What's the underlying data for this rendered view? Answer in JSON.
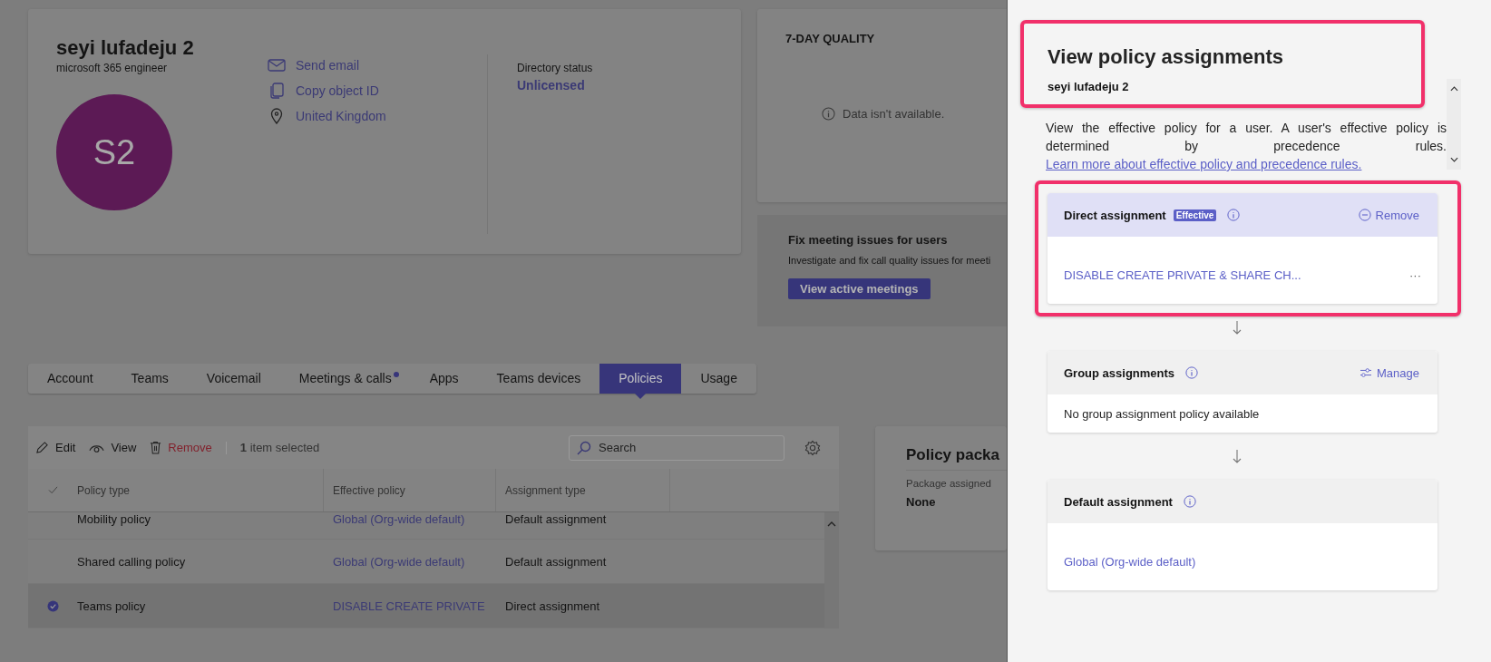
{
  "profile": {
    "name": "seyi lufadeju 2",
    "role": "microsoft 365 engineer",
    "initials": "S2",
    "actions": [
      {
        "kind": "email",
        "label": "Send email"
      },
      {
        "kind": "copy",
        "label": "Copy object ID"
      },
      {
        "kind": "location",
        "label": "United Kingdom"
      }
    ],
    "status_label": "Directory status",
    "status_value": "Unlicensed"
  },
  "quality": {
    "title": "7-DAY QUALITY",
    "message": "Data isn't available."
  },
  "fix_meetings": {
    "title": "Fix meeting issues for users",
    "description": "Investigate and fix call quality issues for meeti",
    "button": "View active meetings"
  },
  "tabs": [
    {
      "label": "Account",
      "selected": false,
      "dot": false
    },
    {
      "label": "Teams",
      "selected": false,
      "dot": false
    },
    {
      "label": "Voicemail",
      "selected": false,
      "dot": false
    },
    {
      "label": "Meetings & calls",
      "selected": false,
      "dot": true
    },
    {
      "label": "Apps",
      "selected": false,
      "dot": false
    },
    {
      "label": "Teams devices",
      "selected": false,
      "dot": false
    },
    {
      "label": "Policies",
      "selected": true,
      "dot": false
    },
    {
      "label": "Usage",
      "selected": false,
      "dot": false
    }
  ],
  "toolbar": {
    "actions": [
      {
        "kind": "edit",
        "label": "Edit"
      },
      {
        "kind": "view",
        "label": "View"
      },
      {
        "kind": "remove",
        "label": "Remove"
      }
    ],
    "selection_count": "1",
    "selection_text": "item selected",
    "search": {
      "placeholder": "Search"
    }
  },
  "table": {
    "columns": [
      "Policy type",
      "Effective policy",
      "Assignment type"
    ],
    "rows": [
      {
        "selected": false,
        "cells": [
          "Mobility policy",
          "Global (Org-wide default)",
          "Default assignment"
        ]
      },
      {
        "selected": false,
        "cells": [
          "Shared calling policy",
          "Global (Org-wide default)",
          "Default assignment"
        ]
      },
      {
        "selected": true,
        "cells": [
          "Teams policy",
          "DISABLE CREATE PRIVATE",
          "Direct assignment"
        ]
      }
    ]
  },
  "policy_package": {
    "title": "Policy packa",
    "label": "Package assigned",
    "value": "None"
  },
  "panel": {
    "title": "View policy assignments",
    "user": "seyi lufadeju 2",
    "highlighted": true,
    "description": "View the effective policy for a user. A user's effective policy is determined by precedence rules.",
    "link": "Learn more about effective policy and precedence rules.",
    "assignments": [
      {
        "title": "Direct assignment",
        "badge": "Effective",
        "effective": true,
        "highlighted": true,
        "action": {
          "kind": "remove",
          "label": "Remove"
        },
        "value": {
          "kind": "link",
          "text": "DISABLE CREATE PRIVATE & SHARE CH..."
        },
        "more": "···"
      },
      {
        "title": "Group assignments",
        "effective": false,
        "highlighted": false,
        "action": {
          "kind": "manage",
          "label": "Manage"
        },
        "value": {
          "kind": "text",
          "text": "No group assignment policy available"
        }
      },
      {
        "title": "Default assignment",
        "effective": false,
        "highlighted": false,
        "value": {
          "kind": "link",
          "text": "Global (Org-wide default)"
        }
      }
    ]
  }
}
